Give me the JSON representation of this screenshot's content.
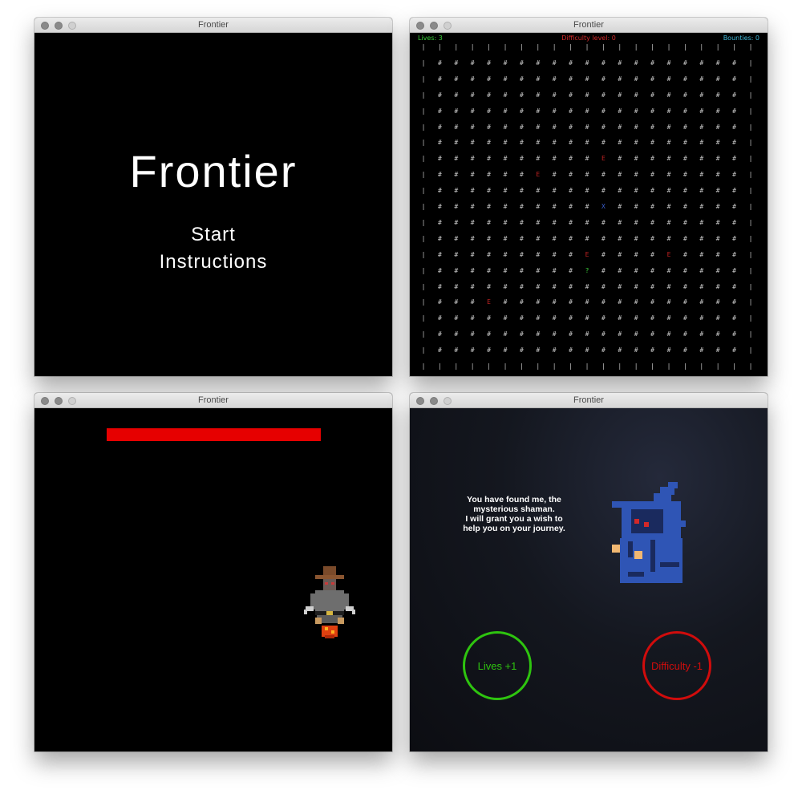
{
  "windows": [
    {
      "title": "Frontier"
    },
    {
      "title": "Frontier"
    },
    {
      "title": "Frontier"
    },
    {
      "title": "Frontier"
    }
  ],
  "menu": {
    "title": "Frontier",
    "items": [
      "Start",
      "Instructions"
    ]
  },
  "map": {
    "hud": {
      "lives": "Lives: 3",
      "difficulty": "Difficulty level: 0",
      "bounties": "Bounties: 0"
    },
    "legend": {
      "wall": "|",
      "floor": "#",
      "enemy": "E",
      "player": "X",
      "mystery": "?"
    },
    "rows": [
      "|||||||||||||||||||||",
      "|###################|",
      "|###################|",
      "|###################|",
      "|###################|",
      "|###################|",
      "|###################|",
      "|##########E########|",
      "|######E############|",
      "|###################|",
      "|##########X########|",
      "|###################|",
      "|###################|",
      "|#########E####E####|",
      "|#########?#########|",
      "|###################|",
      "|###E###############|",
      "|###################|",
      "|###################|",
      "|###################|",
      "|||||||||||||||||||||"
    ],
    "colors": {
      "floor": "#c8c8c8",
      "enemy": "#c22222",
      "player": "#3a5fd0",
      "mystery": "#3ad13a"
    }
  },
  "battle": {
    "health_fraction": 1.0,
    "health_color": "#e60000",
    "player_sprite": "cowboy-icon"
  },
  "shaman": {
    "dialog_lines": [
      "You have found me, the",
      "mysterious shaman.",
      "I will grant you a wish to",
      "help you on your journey."
    ],
    "sprite": "shaman-icon",
    "choices": [
      {
        "label": "Lives +1",
        "color": "#2ec40f"
      },
      {
        "label": "Difficulty -1",
        "color": "#d00c0c"
      }
    ]
  }
}
